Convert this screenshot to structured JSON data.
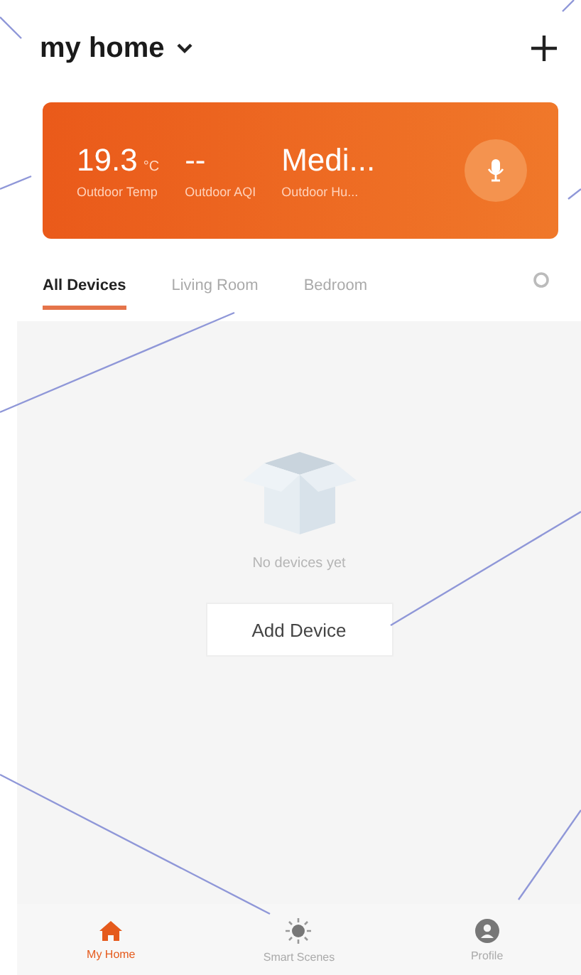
{
  "header": {
    "title": "my home"
  },
  "weather_card": {
    "items": [
      {
        "value": "19.3",
        "unit": "°C",
        "label": "Outdoor Temp"
      },
      {
        "value": "--",
        "label": "Outdoor AQI"
      },
      {
        "value": "Medi...",
        "label": "Outdoor Hu..."
      }
    ]
  },
  "tabs": [
    {
      "label": "All Devices",
      "selected": true
    },
    {
      "label": "Living Room",
      "selected": false
    },
    {
      "label": "Bedroom",
      "selected": false
    }
  ],
  "empty_state": {
    "message": "No devices yet",
    "button": "Add Device"
  },
  "bottom_nav": [
    {
      "label": "My Home",
      "kind": "home",
      "selected": true
    },
    {
      "label": "Smart Scenes",
      "kind": "scenes",
      "selected": false
    },
    {
      "label": "Profile",
      "kind": "profile",
      "selected": false
    }
  ]
}
